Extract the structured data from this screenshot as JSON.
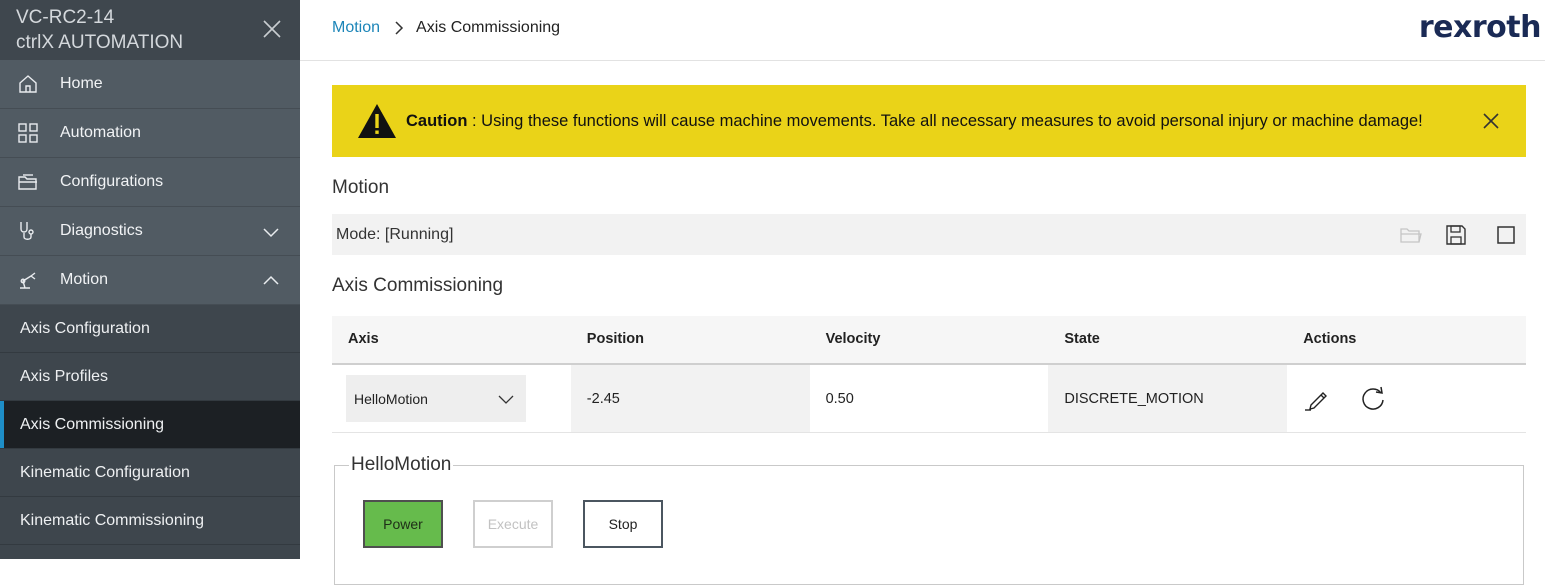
{
  "sidebar": {
    "device_line1": "VC-RC2-14",
    "device_line2": "ctrlX AUTOMATION",
    "items": [
      {
        "label": "Home",
        "icon": "home-icon"
      },
      {
        "label": "Automation",
        "icon": "grid-icon"
      },
      {
        "label": "Configurations",
        "icon": "folder-open-icon"
      },
      {
        "label": "Diagnostics",
        "icon": "stethoscope-icon",
        "expanded": false
      },
      {
        "label": "Motion",
        "icon": "robot-arm-icon",
        "expanded": true
      }
    ],
    "sub_items": [
      {
        "label": "Axis Configuration"
      },
      {
        "label": "Axis Profiles"
      },
      {
        "label": "Axis Commissioning",
        "active": true
      },
      {
        "label": "Kinematic Configuration"
      },
      {
        "label": "Kinematic Commissioning"
      }
    ]
  },
  "header": {
    "breadcrumb_parent": "Motion",
    "breadcrumb_current": "Axis Commissioning",
    "logo": "rexroth"
  },
  "caution": {
    "label": "Caution",
    "message": " : Using these functions will cause machine movements. Take all necessary measures to avoid personal injury or machine damage!"
  },
  "motion_section": {
    "title": "Motion",
    "mode_text": "Mode: [Running]"
  },
  "axis_section": {
    "title": "Axis Commissioning",
    "columns": [
      "Axis",
      "Position",
      "Velocity",
      "State",
      "Actions"
    ],
    "row": {
      "axis": "HelloMotion",
      "position": "-2.45",
      "velocity": "0.50",
      "state": "DISCRETE_MOTION"
    }
  },
  "control_panel": {
    "legend": "HelloMotion",
    "power_label": "Power",
    "execute_label": "Execute",
    "stop_label": "Stop"
  },
  "colors": {
    "sidebar_bg": "#515b63",
    "active_accent": "#1e8ec7",
    "caution_bg": "#ead318",
    "power_green": "#66bb4c",
    "link_blue": "#1c85b8"
  }
}
